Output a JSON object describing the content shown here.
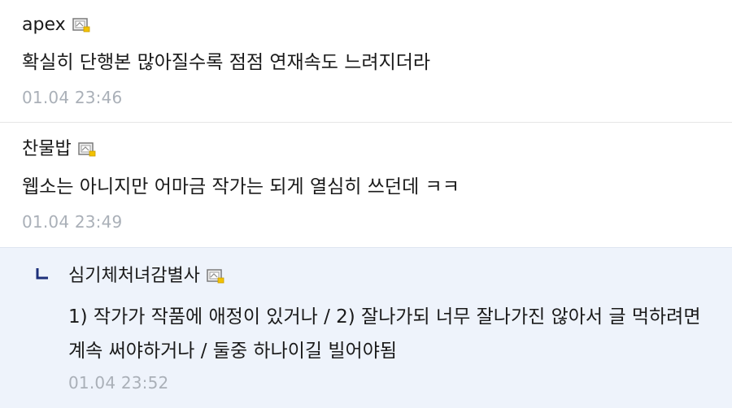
{
  "comments": [
    {
      "author": "apex",
      "member_icon": "member-level-icon",
      "body": "확실히 단행본 많아질수록 점점 연재속도 느려지더라",
      "time": "01.04 23:46"
    },
    {
      "author": "찬물밥",
      "member_icon": "member-level-icon",
      "body": "웹소는 아니지만 어마금 작가는 되게 열심히 쓰던데 ㅋㅋ",
      "time": "01.04 23:49"
    }
  ],
  "reply": {
    "reply_icon": "reply-arrow-icon",
    "author": "심기체처녀감별사",
    "member_icon": "member-level-icon",
    "body": "1) 작가가 작품에 애정이 있거나 / 2) 잘나가되 너무 잘나가진 않아서 글 먹하려면 계속 써야하거나 / 둘중 하나이길 빌어야됨",
    "time": "01.04 23:52"
  },
  "colors": {
    "reply_background": "#eef3fb",
    "reply_arrow": "#1c2f7a",
    "timestamp": "#aab0b8"
  }
}
